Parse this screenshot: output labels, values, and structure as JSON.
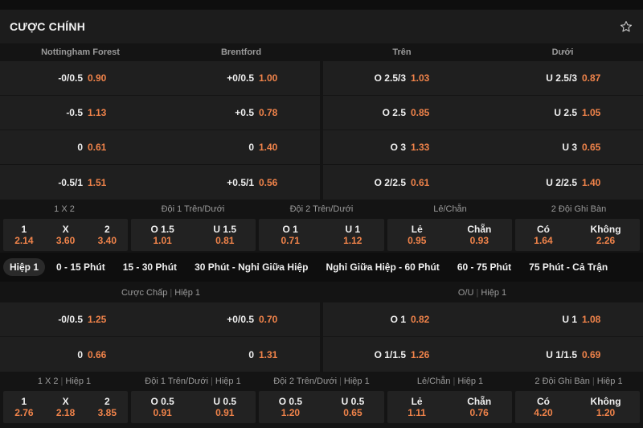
{
  "header": {
    "title": "CƯỢC CHÍNH",
    "star_icon": "star-icon"
  },
  "main": {
    "columns": [
      "Nottingham Forest",
      "Brentford",
      "Trên",
      "Dưới"
    ],
    "handicap_rows": [
      {
        "home_line": "-0/0.5",
        "home_odd": "0.90",
        "away_line": "+0/0.5",
        "away_odd": "1.00"
      },
      {
        "home_line": "-0.5",
        "home_odd": "1.13",
        "away_line": "+0.5",
        "away_odd": "0.78"
      },
      {
        "home_line": "0",
        "home_odd": "0.61",
        "away_line": "0",
        "away_odd": "1.40"
      },
      {
        "home_line": "-0.5/1",
        "home_odd": "1.51",
        "away_line": "+0.5/1",
        "away_odd": "0.56"
      }
    ],
    "ou_rows": [
      {
        "over_line": "O 2.5/3",
        "over_odd": "1.03",
        "under_line": "U 2.5/3",
        "under_odd": "0.87"
      },
      {
        "over_line": "O 2.5",
        "over_odd": "0.85",
        "under_line": "U 2.5",
        "under_odd": "1.05"
      },
      {
        "over_line": "O 3",
        "over_odd": "1.33",
        "under_line": "U 3",
        "under_odd": "0.65"
      },
      {
        "over_line": "O 2/2.5",
        "over_odd": "0.61",
        "under_line": "U 2/2.5",
        "under_odd": "1.40"
      }
    ],
    "markets": [
      {
        "title": "1 X 2",
        "items": [
          {
            "k": "1",
            "v": "2.14"
          },
          {
            "k": "X",
            "v": "3.60"
          },
          {
            "k": "2",
            "v": "3.40"
          }
        ]
      },
      {
        "title": "Đội 1 Trên/Dưới",
        "items": [
          {
            "k": "O 1.5",
            "v": "1.01"
          },
          {
            "k": "U 1.5",
            "v": "0.81"
          }
        ]
      },
      {
        "title": "Đội 2 Trên/Dưới",
        "items": [
          {
            "k": "O 1",
            "v": "0.71"
          },
          {
            "k": "U 1",
            "v": "1.12"
          }
        ]
      },
      {
        "title": "Lẻ/Chẵn",
        "items": [
          {
            "k": "Lẻ",
            "v": "0.95"
          },
          {
            "k": "Chẵn",
            "v": "0.93"
          }
        ]
      },
      {
        "title": "2 Đội Ghi Bàn",
        "items": [
          {
            "k": "Có",
            "v": "1.64"
          },
          {
            "k": "Không",
            "v": "2.26"
          }
        ]
      }
    ]
  },
  "tabs": [
    "Hiệp 1",
    "0 - 15 Phút",
    "15 - 30 Phút",
    "30 Phút - Nghỉ Giữa Hiệp",
    "Nghỉ Giữa Hiệp - 60 Phút",
    "60 - 75 Phút",
    "75 Phút - Cả Trận"
  ],
  "half": {
    "heads": [
      {
        "a": "Cược Chấp",
        "b": "Hiệp 1"
      },
      {
        "a": "O/U",
        "b": "Hiệp 1"
      }
    ],
    "handicap_rows": [
      {
        "home_line": "-0/0.5",
        "home_odd": "1.25",
        "away_line": "+0/0.5",
        "away_odd": "0.70"
      },
      {
        "home_line": "0",
        "home_odd": "0.66",
        "away_line": "0",
        "away_odd": "1.31"
      }
    ],
    "ou_rows": [
      {
        "over_line": "O 1",
        "over_odd": "0.82",
        "under_line": "U 1",
        "under_odd": "1.08"
      },
      {
        "over_line": "O 1/1.5",
        "over_odd": "1.26",
        "under_line": "U 1/1.5",
        "under_odd": "0.69"
      }
    ],
    "markets": [
      {
        "title": "1 X 2",
        "sub": "Hiệp 1",
        "items": [
          {
            "k": "1",
            "v": "2.76"
          },
          {
            "k": "X",
            "v": "2.18"
          },
          {
            "k": "2",
            "v": "3.85"
          }
        ]
      },
      {
        "title": "Đội 1 Trên/Dưới",
        "sub": "Hiệp 1",
        "items": [
          {
            "k": "O 0.5",
            "v": "0.91"
          },
          {
            "k": "U 0.5",
            "v": "0.91"
          }
        ]
      },
      {
        "title": "Đội 2 Trên/Dưới",
        "sub": "Hiệp 1",
        "items": [
          {
            "k": "O 0.5",
            "v": "1.20"
          },
          {
            "k": "U 0.5",
            "v": "0.65"
          }
        ]
      },
      {
        "title": "Lẻ/Chẵn",
        "sub": "Hiệp 1",
        "items": [
          {
            "k": "Lẻ",
            "v": "1.11"
          },
          {
            "k": "Chẵn",
            "v": "0.76"
          }
        ]
      },
      {
        "title": "2 Đội Ghi Bàn",
        "sub": "Hiệp 1",
        "items": [
          {
            "k": "Có",
            "v": "4.20"
          },
          {
            "k": "Không",
            "v": "1.20"
          }
        ]
      }
    ]
  },
  "colors": {
    "odd": "#f0834a",
    "bg": "#141414",
    "panel": "#1f1f1f"
  }
}
